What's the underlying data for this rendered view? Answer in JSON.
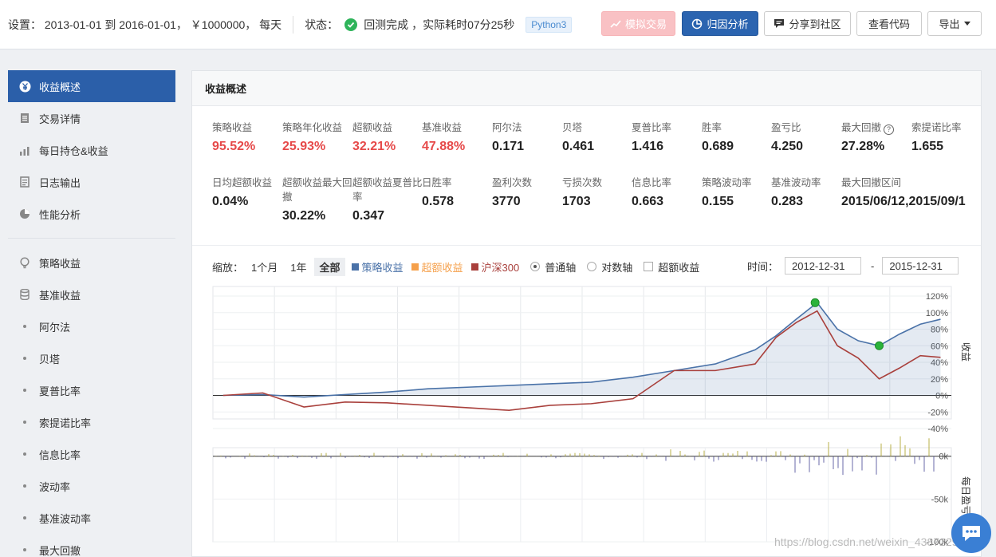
{
  "topbar": {
    "settings_text": "设置： 2013-01-01 到 2016-01-01， ￥1000000， 每天",
    "status_label": "状态：",
    "status_text": "回测完成 ，实际耗时07分25秒",
    "language_badge": "Python3",
    "buttons": {
      "simulate": "模拟交易",
      "attribution": "归因分析",
      "share": "分享到社区",
      "view_code": "查看代码",
      "export": "导出"
    }
  },
  "sidebar": {
    "items": [
      {
        "label": "收益概述",
        "icon": "yen-icon",
        "active": true
      },
      {
        "label": "交易详情",
        "icon": "document-icon"
      },
      {
        "label": "每日持仓&收益",
        "icon": "bar-chart-icon"
      },
      {
        "label": "日志输出",
        "icon": "log-icon"
      },
      {
        "label": "性能分析",
        "icon": "pie-icon"
      }
    ],
    "metric_items": [
      {
        "label": "策略收益",
        "icon": "bulb-icon"
      },
      {
        "label": "基准收益",
        "icon": "database-icon"
      },
      {
        "label": "阿尔法"
      },
      {
        "label": "贝塔"
      },
      {
        "label": "夏普比率"
      },
      {
        "label": "索提诺比率"
      },
      {
        "label": "信息比率"
      },
      {
        "label": "波动率"
      },
      {
        "label": "基准波动率"
      },
      {
        "label": "最大回撤"
      }
    ]
  },
  "main": {
    "title": "收益概述",
    "metrics_row1": [
      {
        "label": "策略收益",
        "value": "95.52%",
        "red": true
      },
      {
        "label": "策略年化收益",
        "value": "25.93%",
        "red": true
      },
      {
        "label": "超额收益",
        "value": "32.21%",
        "red": true
      },
      {
        "label": "基准收益",
        "value": "47.88%",
        "red": true
      },
      {
        "label": "阿尔法",
        "value": "0.171"
      },
      {
        "label": "贝塔",
        "value": "0.461"
      },
      {
        "label": "夏普比率",
        "value": "1.416"
      },
      {
        "label": "胜率",
        "value": "0.689"
      },
      {
        "label": "盈亏比",
        "value": "4.250"
      },
      {
        "label": "最大回撤",
        "value": "27.28%",
        "help": true
      },
      {
        "label": "索提诺比率",
        "value": "1.655"
      }
    ],
    "metrics_row2": [
      {
        "label": "日均超额收益",
        "value": "0.04%"
      },
      {
        "label": "超额收益最大回撤",
        "value": "30.22%"
      },
      {
        "label": "超额收益夏普比率",
        "value": "0.347"
      },
      {
        "label": "日胜率",
        "value": "0.578"
      },
      {
        "label": "盈利次数",
        "value": "3770"
      },
      {
        "label": "亏损次数",
        "value": "1703"
      },
      {
        "label": "信息比率",
        "value": "0.663"
      },
      {
        "label": "策略波动率",
        "value": "0.155"
      },
      {
        "label": "基准波动率",
        "value": "0.283"
      },
      {
        "label": "最大回撤区间",
        "value": "2015/06/12,2015/09/1"
      }
    ],
    "help_glyph": "?",
    "controls": {
      "zoom_label": "缩放：",
      "zoom_options": [
        "1个月",
        "1年",
        "全部"
      ],
      "legend_strategy": "策略收益",
      "legend_excess": "超额收益",
      "legend_benchmark": "沪深300",
      "radio_normal": "普通轴",
      "radio_log": "对数轴",
      "checkbox_excess": "超额收益",
      "time_label": "时间：",
      "time_start": "2012-12-31",
      "time_end": "2015-12-31",
      "time_dash": "-"
    },
    "colors": {
      "strategy": "#4a72a8",
      "excess": "#f5a04b",
      "benchmark": "#a9403c",
      "accent": "#2b5fa9"
    },
    "watermark": "https://blog.csdn.net/weixin_43872291"
  },
  "chart_data": [
    {
      "type": "line",
      "ylabel": "收益",
      "y_ticks": [
        "120%",
        "100%",
        "80%",
        "60%",
        "40%",
        "20%",
        "0%",
        "-20%",
        "-40%"
      ],
      "ylim": [
        -40,
        120
      ],
      "x_range": [
        "2012-12-31",
        "2015-12-31"
      ],
      "series": [
        {
          "name": "策略收益",
          "x": [
            "2013-01",
            "2013-03",
            "2013-05",
            "2013-07",
            "2013-09",
            "2013-11",
            "2014-01",
            "2014-03",
            "2014-05",
            "2014-07",
            "2014-09",
            "2014-11",
            "2015-01",
            "2015-03",
            "2015-04",
            "2015-05",
            "2015-06",
            "2015-07",
            "2015-08",
            "2015-09",
            "2015-10",
            "2015-11",
            "2015-12"
          ],
          "values": [
            0,
            1,
            -2,
            1,
            4,
            8,
            10,
            12,
            14,
            16,
            22,
            30,
            38,
            55,
            72,
            92,
            112,
            80,
            66,
            60,
            74,
            86,
            92
          ]
        },
        {
          "name": "沪深300",
          "x": [
            "2013-01",
            "2013-03",
            "2013-05",
            "2013-07",
            "2013-09",
            "2013-11",
            "2014-01",
            "2014-03",
            "2014-05",
            "2014-07",
            "2014-09",
            "2014-11",
            "2015-01",
            "2015-03",
            "2015-04",
            "2015-05",
            "2015-06",
            "2015-07",
            "2015-08",
            "2015-09",
            "2015-10",
            "2015-11",
            "2015-12"
          ],
          "values": [
            0,
            3,
            -14,
            -8,
            -9,
            -12,
            -15,
            -18,
            -12,
            -10,
            -4,
            30,
            30,
            38,
            70,
            88,
            102,
            60,
            45,
            20,
            33,
            48,
            46
          ]
        }
      ],
      "markers": [
        {
          "label": "max_drawdown_start",
          "x": "2015-06-12",
          "value": 112
        },
        {
          "label": "max_drawdown_end",
          "x": "2015-09",
          "value": 60
        }
      ]
    },
    {
      "type": "bar",
      "ylabel": "每日盈亏",
      "y_ticks": [
        "0k",
        "-50k",
        "-100k"
      ],
      "ylim": [
        -100,
        10
      ]
    }
  ]
}
